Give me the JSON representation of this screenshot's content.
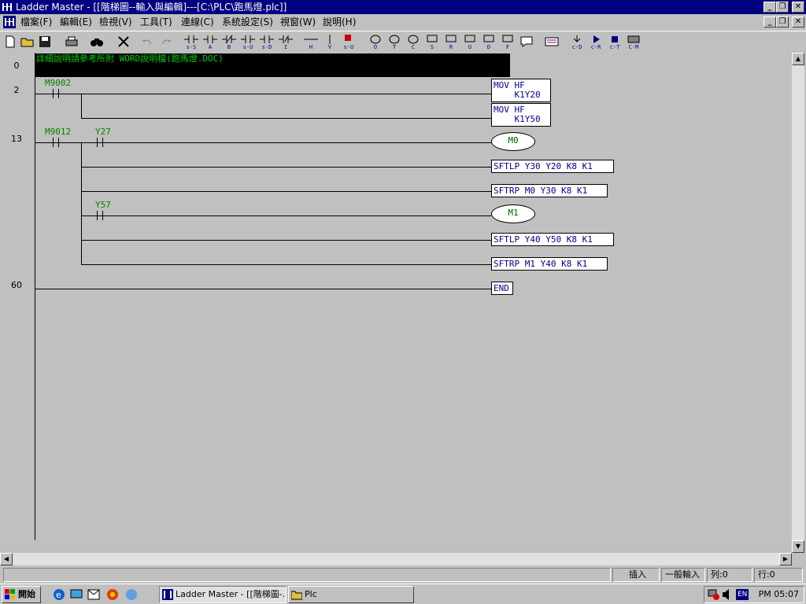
{
  "window": {
    "title": "Ladder Master - [[階梯圖--輸入與編輯]---[C:\\PLC\\跑馬燈.plc]]"
  },
  "menu": {
    "items": [
      "檔案(F)",
      "編輯(E)",
      "檢視(V)",
      "工具(T)",
      "連線(C)",
      "系統設定(S)",
      "視窗(W)",
      "說明(H)"
    ]
  },
  "toolbar": {
    "contact_labels": [
      "s-S",
      "A",
      "B",
      "s-U",
      "s-D",
      "I",
      "H",
      "V",
      "s-U"
    ],
    "coil_labels": [
      "O",
      "T",
      "C",
      "S",
      "R",
      "U",
      "D",
      "F"
    ],
    "extra_labels": [
      "c-D",
      "c-R",
      "c-T",
      "C-M"
    ]
  },
  "ladder": {
    "row_numbers": [
      "0",
      "2",
      "13",
      "60"
    ],
    "comment": "詳細說明請參考所附 WORD說明檔(跑馬燈.DOC)",
    "contacts": [
      "M9002",
      "M9012",
      "Y27",
      "Y57"
    ],
    "instructions": [
      "MOV HF\n    K1Y20",
      "MOV HF\n    K1Y50",
      "SFTLP Y30 Y20 K8 K1",
      "SFTRP M0 Y30 K8 K1",
      "SFTLP Y40 Y50 K8 K1",
      "SFTRP M1 Y40 K8 K1",
      "END"
    ],
    "coils": [
      "M0",
      "M1"
    ]
  },
  "statusbar": {
    "mode": "插入",
    "input_mode": "一般輸入",
    "column": "列:0",
    "row": "行:0"
  },
  "taskbar": {
    "start_label": "開始",
    "tasks": [
      "Ladder Master - [[階梯圖-...",
      "Plc"
    ],
    "tray_lang": "EN",
    "clock": "PM 05:07"
  }
}
